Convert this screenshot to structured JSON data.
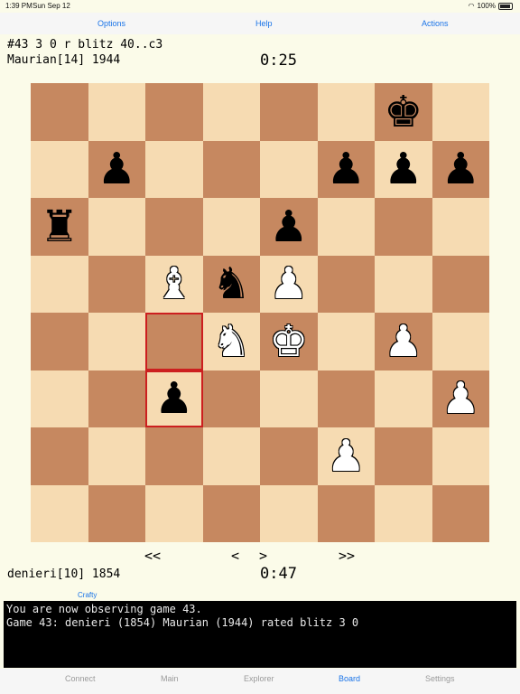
{
  "status": {
    "time": "1:39 PM",
    "date": "Sun Sep 12",
    "battery": "100%"
  },
  "topbar": {
    "options": "Options",
    "help": "Help",
    "actions": "Actions"
  },
  "game": {
    "header": "#43 3 0 r blitz   40..c3",
    "top_player": "Maurian[14] 1944",
    "top_clock": "0:25",
    "bottom_player": "denieri[10] 1854",
    "bottom_clock": "0:47"
  },
  "board": {
    "highlight": [
      "c4",
      "c3"
    ],
    "pieces": {
      "g8": "bK",
      "b7": "bP",
      "f7": "bP",
      "g7": "bP",
      "h7": "bP",
      "a6": "bR",
      "e6": "bP",
      "c5": "wB",
      "d5": "bN",
      "e5": "wP",
      "d4": "wN",
      "e4": "wK",
      "g4": "wP",
      "c3": "bP",
      "h3": "wP",
      "f2": "wP"
    },
    "glyphs": {
      "K": "♚",
      "Q": "♛",
      "R": "♜",
      "B": "♝",
      "N": "♞",
      "P": "♟"
    }
  },
  "nav": {
    "first": "<<",
    "prev": "<",
    "next": ">",
    "last": ">>"
  },
  "engine": "Crafty",
  "console": [
    "You are now observing game 43.",
    "Game 43: denieri (1854) Maurian (1944) rated blitz 3 0"
  ],
  "tabs": [
    "Connect",
    "Main",
    "Explorer",
    "Board",
    "Settings"
  ],
  "active_tab": "Board",
  "colors": {
    "accent": "#1a74e8",
    "light_square": "#f6dbb2",
    "dark_square": "#c68860",
    "highlight": "#cc1f1f"
  }
}
